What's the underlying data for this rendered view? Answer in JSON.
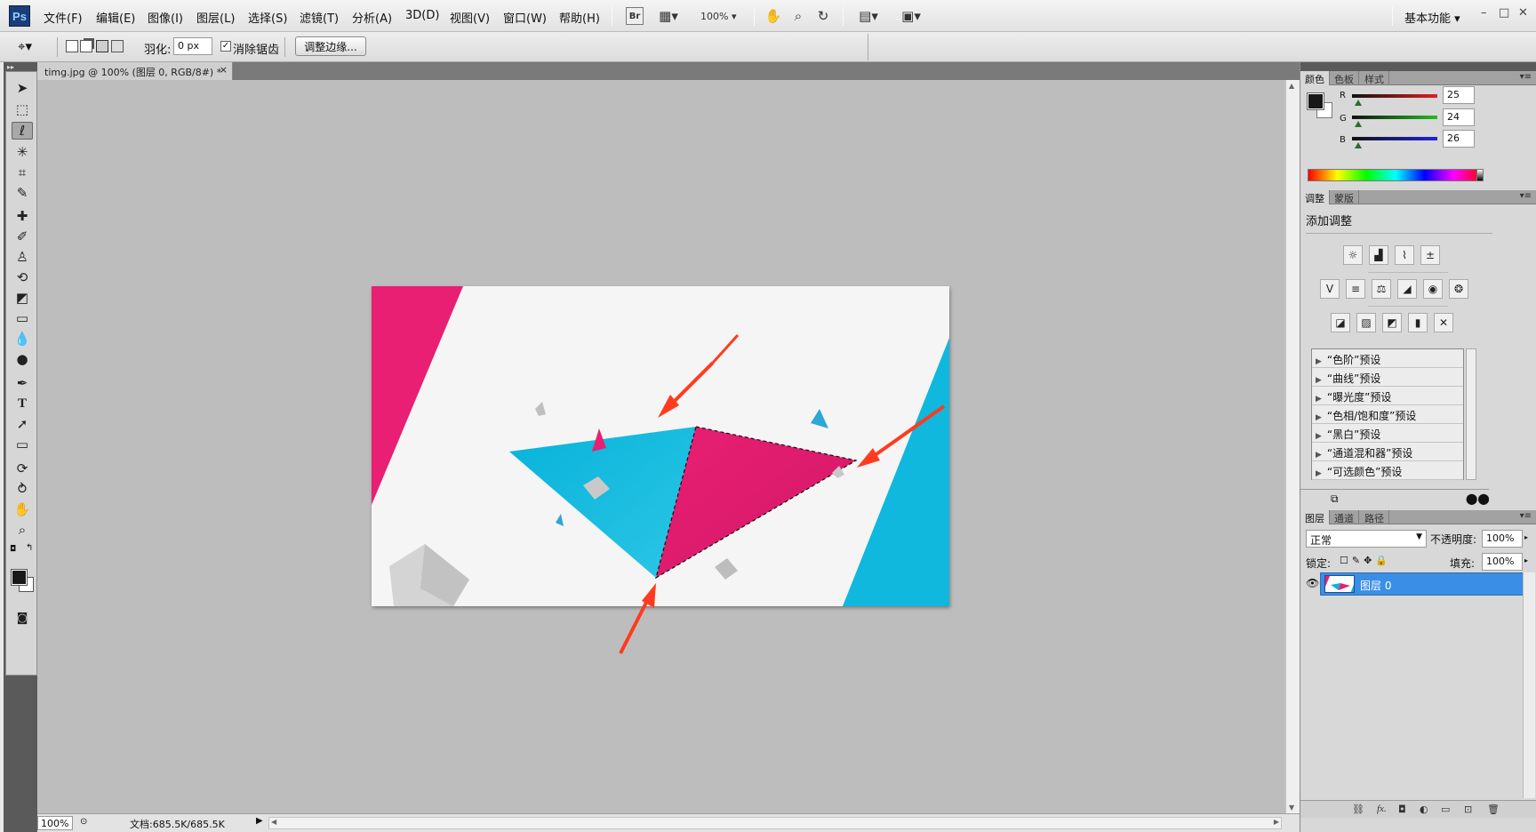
{
  "app": {
    "logo": "Ps"
  },
  "menu": [
    "文件(F)",
    "编辑(E)",
    "图像(I)",
    "图层(L)",
    "选择(S)",
    "滤镜(T)",
    "分析(A)",
    "3D(D)",
    "视图(V)",
    "窗口(W)",
    "帮助(H)"
  ],
  "appbar": {
    "bridge": "Br",
    "zoom": "100%",
    "workspace": "基本功能"
  },
  "options": {
    "feather_label": "羽化:",
    "feather_value": "0 px",
    "antialias_label": "消除锯齿",
    "antialias_checked": true,
    "refine_edge": "调整边缘..."
  },
  "document": {
    "tab_title": "timg.jpg @ 100% (图层 0, RGB/8#) *",
    "close": "×"
  },
  "status": {
    "zoom": "100%",
    "doc_size": "文档:685.5K/685.5K"
  },
  "color_panel": {
    "tabs": [
      "颜色",
      "色板",
      "样式"
    ],
    "channels": [
      {
        "label": "R",
        "value": "25",
        "color": "#cc2222"
      },
      {
        "label": "G",
        "value": "24",
        "color": "#22aa22"
      },
      {
        "label": "B",
        "value": "26",
        "color": "#2222cc"
      }
    ],
    "foreground": "#191819"
  },
  "adjustments_panel": {
    "tabs": [
      "调整",
      "蒙版"
    ],
    "heading": "添加调整",
    "presets": [
      "“色阶”预设",
      "“曲线”预设",
      "“曝光度”预设",
      "“色相/饱和度”预设",
      "“黑白”预设",
      "“通道混和器”预设",
      "“可选颜色”预设"
    ]
  },
  "layers_panel": {
    "tabs": [
      "图层",
      "通道",
      "路径"
    ],
    "blend_mode": "正常",
    "opacity_label": "不透明度:",
    "opacity": "100%",
    "lock_label": "锁定:",
    "fill_label": "填充:",
    "fill": "100%",
    "layers": [
      {
        "name": "图层 0",
        "selected": true
      }
    ]
  },
  "artwork_colors": {
    "magenta": "#e81f73",
    "cyan": "#08b3d9",
    "annotation_arrow": "#ff3b1f"
  }
}
